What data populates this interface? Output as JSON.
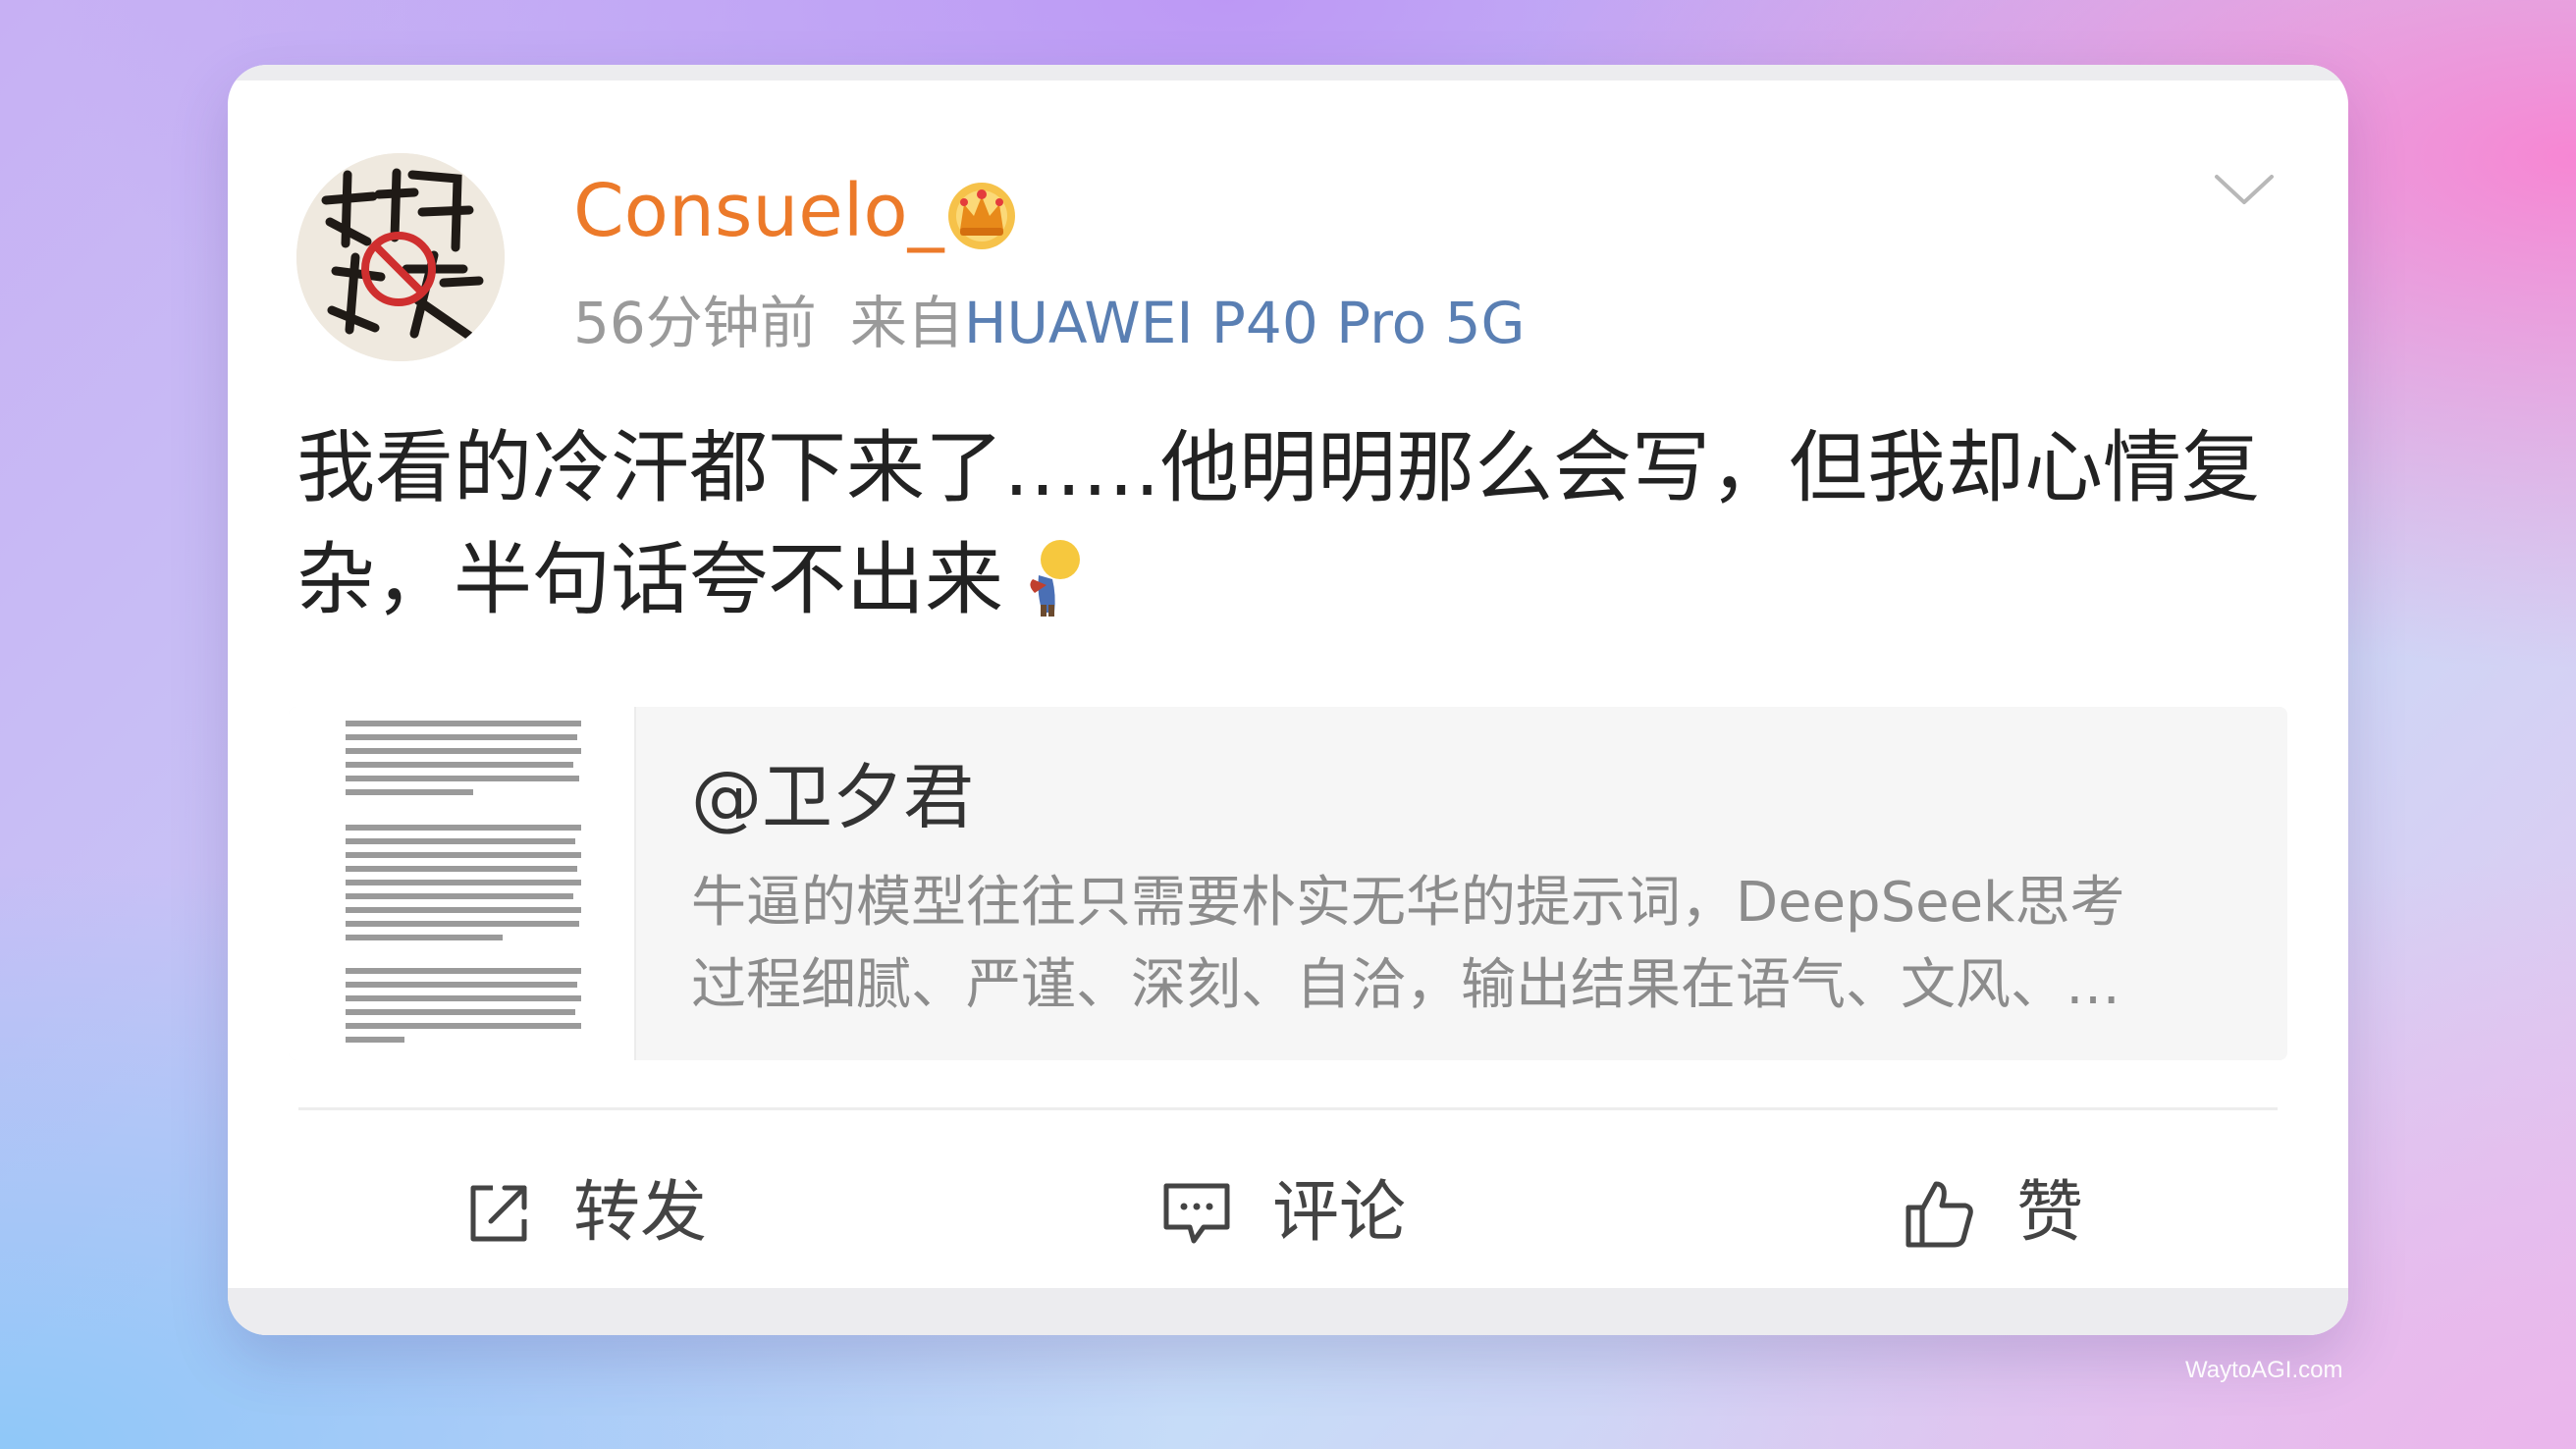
{
  "post": {
    "username": "Consuelo_",
    "time": "56分钟前",
    "source_prefix": "来自",
    "source_device": "HUAWEI P40 Pro 5G",
    "text_line1": "我看的冷汗都下来了……他明明那么会写，但我却心情复",
    "text_line2": "杂，半句话夸不出来",
    "emoji": "facepalm-emoji",
    "avatar_icon": "avatar-calligraphy-icon",
    "badge_icon": "crown-badge-icon"
  },
  "quote": {
    "user": "@卫夕君",
    "line1": "牛逼的模型往往只需要朴实无华的提示词，DeepSeek思考",
    "line2": "过程细腻、严谨、深刻、自洽，输出结果在语气、文风、…"
  },
  "actions": {
    "repost_label": "转发",
    "comment_label": "评论",
    "like_label": "赞"
  },
  "colors": {
    "username": "#ec7a2a",
    "source_link": "#5a7fb3",
    "meta": "#9a9a9a",
    "body_text": "#222222"
  },
  "watermark": "WaytoAGI.com"
}
